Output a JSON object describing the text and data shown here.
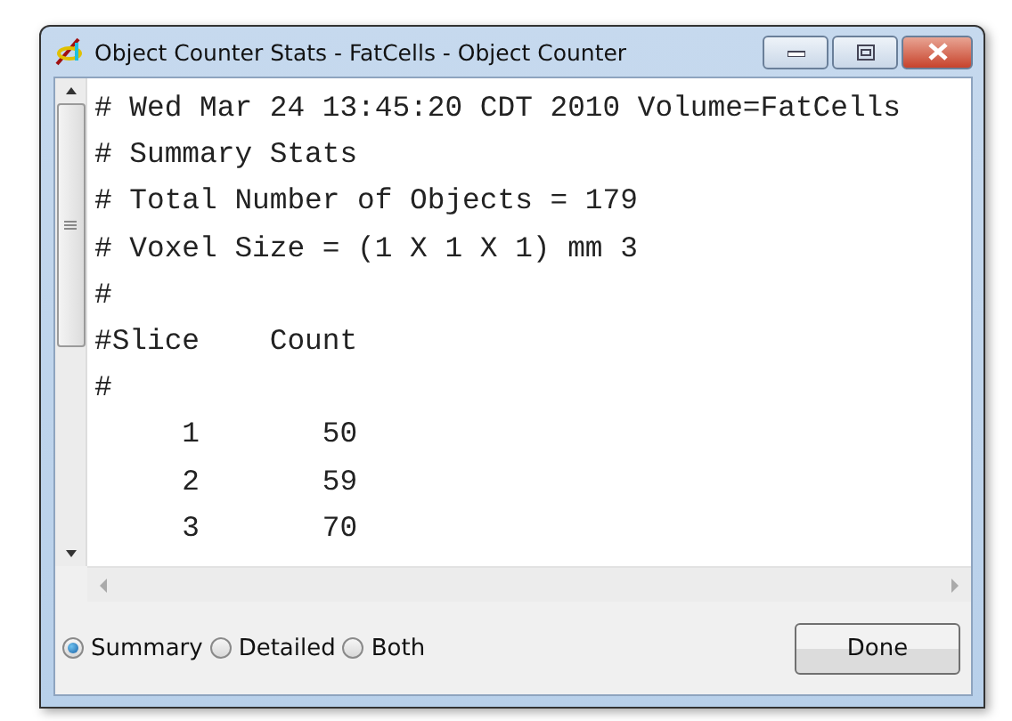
{
  "window": {
    "title": "Object Counter Stats - FatCells - Object Counter"
  },
  "text_lines": [
    "# Wed Mar 24 13:45:20 CDT 2010 Volume=FatCells",
    "# Summary Stats",
    "# Total Number of Objects = 179",
    "# Voxel Size = (1 X 1 X 1) mm 3",
    "#",
    "#Slice    Count",
    "#",
    "     1       50",
    "     2       59",
    "     3       70"
  ],
  "options": [
    {
      "label": "Summary",
      "selected": true
    },
    {
      "label": "Detailed",
      "selected": false
    },
    {
      "label": "Both",
      "selected": false
    }
  ],
  "buttons": [
    "Done"
  ]
}
